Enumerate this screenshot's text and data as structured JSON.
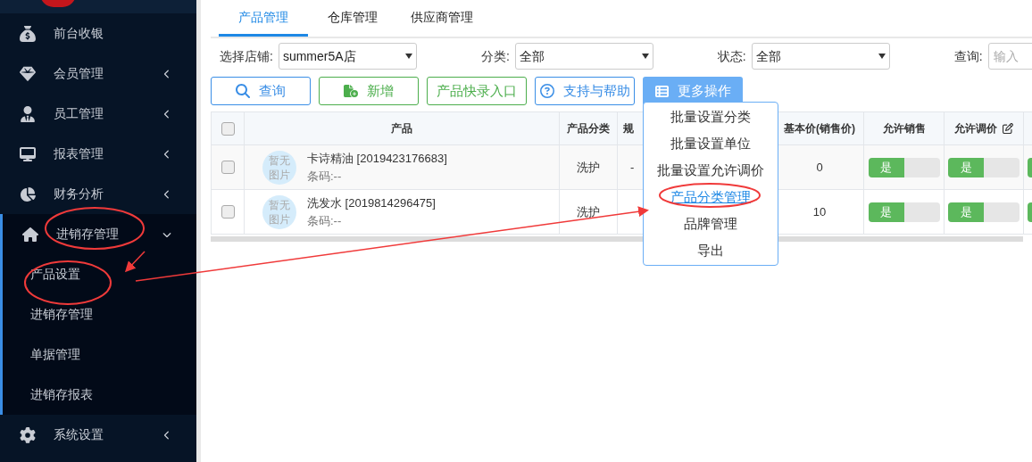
{
  "sidebar": {
    "items": [
      {
        "label": "前台收银",
        "kind": "link"
      },
      {
        "label": "会员管理",
        "kind": "group",
        "expanded": false
      },
      {
        "label": "员工管理",
        "kind": "group",
        "expanded": false
      },
      {
        "label": "报表管理",
        "kind": "group",
        "expanded": false
      },
      {
        "label": "财务分析",
        "kind": "group",
        "expanded": false
      },
      {
        "label": "进销存管理",
        "kind": "group",
        "expanded": true,
        "children": [
          {
            "label": "产品设置"
          },
          {
            "label": "进销存管理"
          },
          {
            "label": "单据管理"
          },
          {
            "label": "进销存报表"
          }
        ]
      },
      {
        "label": "系统设置",
        "kind": "group",
        "expanded": false
      }
    ]
  },
  "tabs": [
    {
      "label": "产品管理",
      "selected": true
    },
    {
      "label": "仓库管理",
      "selected": false
    },
    {
      "label": "供应商管理",
      "selected": false
    }
  ],
  "filters": {
    "store": {
      "label": "选择店铺:",
      "value": "summer5A店"
    },
    "category": {
      "label": "分类:",
      "value": "全部"
    },
    "status": {
      "label": "状态:",
      "value": "全部"
    },
    "query": {
      "label": "查询:",
      "placeholder": "输入"
    }
  },
  "buttons": [
    {
      "label": "查询",
      "kind": "search"
    },
    {
      "label": "新增",
      "kind": "add"
    },
    {
      "label": "产品快录入口",
      "kind": "plain"
    },
    {
      "label": "支持与帮助",
      "kind": "help"
    }
  ],
  "more_button": {
    "label": "更多操作",
    "expanded": true,
    "menu": [
      {
        "label": "批量设置分类",
        "selected": false
      },
      {
        "label": "批量设置单位",
        "selected": false
      },
      {
        "label": "批量设置允许调价",
        "selected": false
      },
      {
        "label": "产品分类管理",
        "selected": true
      },
      {
        "label": "品牌管理",
        "selected": false
      },
      {
        "label": "导出",
        "selected": false
      }
    ]
  },
  "table": {
    "select_all_checked": false,
    "columns": [
      "产品",
      "产品分类",
      "规",
      "基本价(销售价)",
      "允许销售",
      "允许调价"
    ],
    "rows": [
      {
        "checked": false,
        "image": "暂无图片",
        "name": "卡诗精油 [2019423176683]",
        "barcode": "条码:--",
        "category": "洗护",
        "spec": "-",
        "price": "0",
        "allow_sale": {
          "label": "是",
          "on": true
        },
        "allow_price": {
          "label": "是",
          "on": true
        },
        "column_9_on": true
      },
      {
        "checked": false,
        "image": "暂无图片",
        "name": "洗发水 [2019814296475]",
        "barcode": "条码:--",
        "category": "洗护",
        "price": "10",
        "allow_sale": {
          "label": "是",
          "on": true
        },
        "allow_price": {
          "label": "是",
          "on": true
        },
        "column_9_on": true
      }
    ]
  }
}
